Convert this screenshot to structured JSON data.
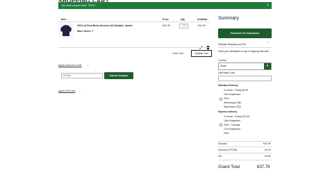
{
  "page": {
    "title_fragment": "SHOPPING CART"
  },
  "flash": {
    "message": "You used coupon code \"CP10\".",
    "close_glyph": "×"
  },
  "cart": {
    "headers": {
      "item": "Item",
      "price": "Price",
      "qty": "Qty",
      "subtotal": "Subtotal"
    },
    "item": {
      "name": "2023-24 Real Betis Hummel All-Weather Jacket",
      "more_sizes_label": "More Sizes:",
      "more_sizes_value": "S",
      "price": "€41.99",
      "qty": "1.0",
      "subtotal": "€41.99"
    },
    "clear_cart": "Clear Cart",
    "update_cart": "Update Cart"
  },
  "discount": {
    "toggle_label": "Apply Discount Code",
    "code_value": "CP10D",
    "cancel_label": "Cancel Coupon"
  },
  "gift_card": {
    "toggle_label": "Apply Gift Card"
  },
  "summary": {
    "title": "Summary",
    "checkout": "Proceed To Checkout",
    "estimate_label": "Estimate Shipping and Tax",
    "estimate_hint": "Enter your destination to get a shipping estimate.",
    "country_label": "Country",
    "country_value": "Spain",
    "zip_label": "Zip/Postal Code",
    "standard": {
      "title": "Standard Delivery",
      "line1": "To Arrive : Friday €6.99",
      "line2": "20th September",
      "line3": "2024 -",
      "line4": "Wednesday 25th",
      "line5": "September 2024"
    },
    "express": {
      "title": "Express Delivery",
      "line1": "To Arrive : Friday €19.99",
      "line2": "13th September",
      "line3": "2024 - Tuesday",
      "line4": "17th September",
      "line5": "2024"
    },
    "totals": {
      "subtotal_label": "Subtotal",
      "subtotal_value": "€41.99",
      "discount_label": "Discount (CP10D)",
      "discount_value": "-€4.20",
      "tax_label": "Tax",
      "tax_value": "€6.56",
      "grand_label": "Grand Total",
      "grand_value": "€37.79"
    }
  },
  "colors": {
    "brand_green": "#1f5c2e",
    "flash_green": "#1f7a3d"
  }
}
